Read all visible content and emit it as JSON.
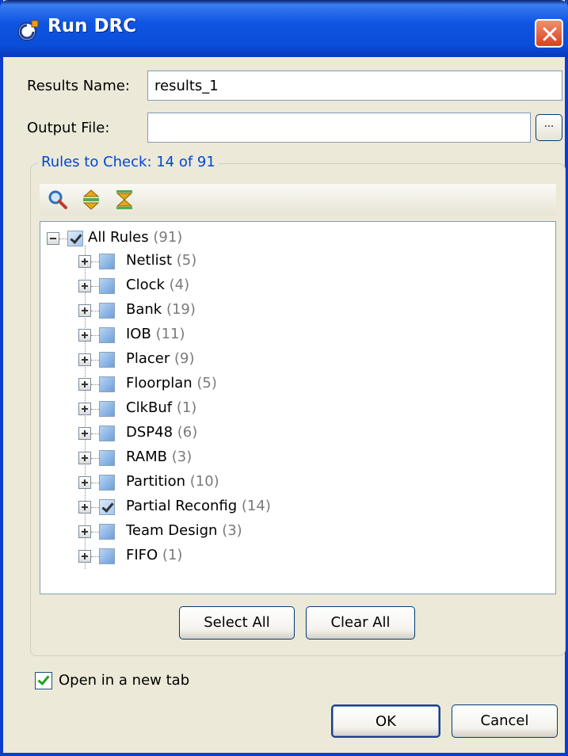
{
  "window": {
    "title": "Run DRC",
    "icons": {
      "app": "drc-app-icon",
      "close": "close-icon"
    },
    "title_bar_color": "#0A4DD8",
    "close_color": "#D8401E"
  },
  "form": {
    "results_name_label": "Results Name:",
    "results_name_value": "results_1",
    "output_file_label": "Output File:",
    "output_file_value": "",
    "browse_label": "..."
  },
  "rules": {
    "group_title": "Rules to Check: 14 of 91",
    "toolbar_icons": [
      "search-icon",
      "expand-all-icon",
      "collapse-all-icon"
    ],
    "root": {
      "label": "All Rules",
      "count": "(91)",
      "checked": true,
      "expanded": true
    },
    "items": [
      {
        "label": "Netlist",
        "count": "(5)",
        "checked": false
      },
      {
        "label": "Clock",
        "count": "(4)",
        "checked": false
      },
      {
        "label": "Bank",
        "count": "(19)",
        "checked": false
      },
      {
        "label": "IOB",
        "count": "(11)",
        "checked": false
      },
      {
        "label": "Placer",
        "count": "(9)",
        "checked": false
      },
      {
        "label": "Floorplan",
        "count": "(5)",
        "checked": false
      },
      {
        "label": "ClkBuf",
        "count": "(1)",
        "checked": false
      },
      {
        "label": "DSP48",
        "count": "(6)",
        "checked": false
      },
      {
        "label": "RAMB",
        "count": "(3)",
        "checked": false
      },
      {
        "label": "Partition",
        "count": "(10)",
        "checked": false
      },
      {
        "label": "Partial Reconfig",
        "count": "(14)",
        "checked": true
      },
      {
        "label": "Team Design",
        "count": "(3)",
        "checked": false
      },
      {
        "label": "FIFO",
        "count": "(1)",
        "checked": false
      }
    ],
    "select_all_label": "Select All",
    "clear_all_label": "Clear All"
  },
  "options": {
    "open_new_tab_label": "Open in a new tab",
    "open_new_tab_checked": true
  },
  "buttons": {
    "ok_label": "OK",
    "cancel_label": "Cancel"
  }
}
